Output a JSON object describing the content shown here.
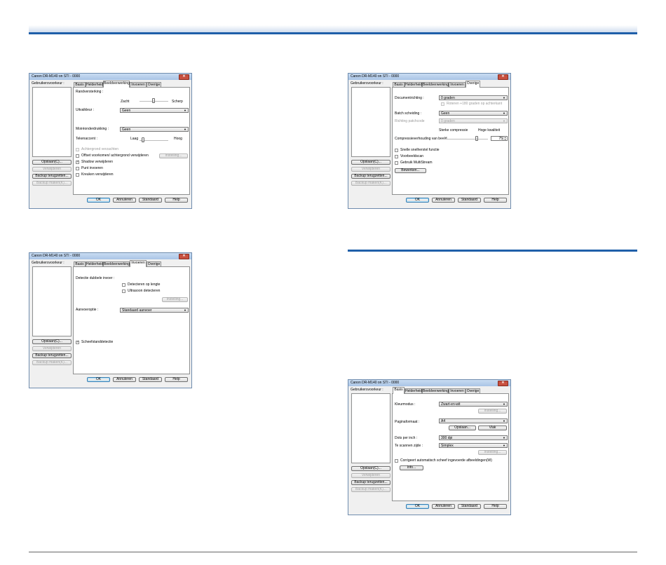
{
  "window_title": "Canon DR-M140 on STI - 0000",
  "close_glyph": "✕",
  "user_preferences_label": "Gebruikersvoorkeur :",
  "side_buttons": {
    "save": "Opslaan(C)...",
    "delete": "Verwijderen",
    "backup_restore": "Backup terugzetten...",
    "backup_make": "Backup maken(K)..."
  },
  "tabs": {
    "basis": "Basis",
    "helderheid": "Helderheid",
    "beeldverwerking": "Beeldverwerking",
    "invoeren": "Invoeren",
    "overige": "Overige"
  },
  "footer_buttons": {
    "ok": "OK",
    "cancel": "Annuleren",
    "standard": "Standaard",
    "help": "Help"
  },
  "dialog_image_processing": {
    "edge_emphasis": "Randversterking :",
    "smooth": "Zacht",
    "sharp": "Scherp",
    "dropout_color": "Uitvalkleur :",
    "dropout_value": "Geen",
    "moire_reduction": "Moiréonderdrukking :",
    "moire_value": "Geen",
    "character_emphasis": "Tekenaccent :",
    "low": "Laag",
    "high": "Hoog",
    "cb_background_smoothing": "Achtergrond verzachten",
    "cb_offset_remove": "Offset voorkomen/ achtergrond verwijderen",
    "settings_btn": "Instelling...",
    "cb_shadow_remove": "Shadow verwijderen",
    "cb_punch_holes": "Punt invoeren",
    "cb_ink_remove": "Kreuken verwijderen"
  },
  "dialog_feeding": {
    "double_feed_title": "Detectie dubbele invoer :",
    "cb_detect_length": "Detecteren op lengte",
    "cb_ultrasonic": "Ultrasoon detecteren",
    "settings_btn": "Instelling...",
    "feeding_option": "Aanvoeroptie :",
    "feeding_value": "Standaard aanvoer",
    "cb_skew_detection": "Scheefstanddetectie"
  },
  "dialog_other": {
    "document_orientation": "Documentrichting :",
    "orientation_value": "0 graden",
    "cb_rotate_180": "Roteren +180 graden op achterkant",
    "batch_separation": "Batch scheiding :",
    "batch_value": "Geen",
    "patch_code_direction": "Richting patchcode",
    "patch_value": "0 graden",
    "strong_compression": "Sterke compressie",
    "high_quality": "Hoge kwaliteit",
    "image_quality_label": "Compressieverhouding van beeld",
    "image_quality_value": "75",
    "cb_fast_recovery": "Snelle snelherstel functie",
    "cb_prescan": "Voorbeeldscan",
    "cb_multistream": "Gebruik MultiStream",
    "edit_btn": "Bewerken..."
  },
  "dialog_basic": {
    "mode": "Kleurmodus :",
    "mode_value": "Zwart-en-wit",
    "settings_btn": "Instelling...",
    "page_size": "Paginaformaat :",
    "page_size_value": "A4",
    "save_btn": "Opslaan...",
    "area_btn": "Vlak",
    "dpi": "Dots per inch :",
    "dpi_value": "300 dpi",
    "scan_side": "Te scannen zijde :",
    "scan_side_value": "Simplex",
    "settings_btn2": "Instelling...",
    "cb_deskew": "Corrigeert automatisch scheef ingevoerde afbeeldingen(W)",
    "info_btn": "Info..."
  }
}
